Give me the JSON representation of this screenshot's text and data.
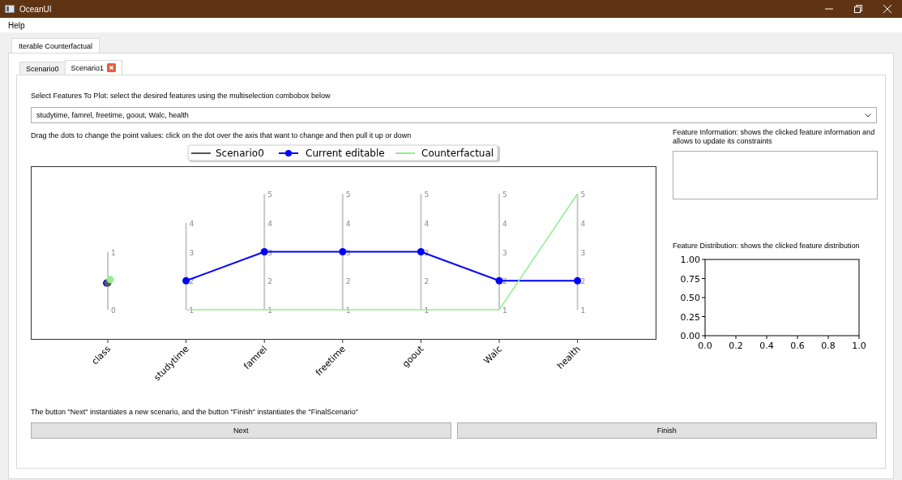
{
  "window": {
    "title": "OceanUI"
  },
  "menu": [
    "Help"
  ],
  "outer_tabs": [
    {
      "label": "Iterable Counterfactual",
      "selected": true
    }
  ],
  "scenario_tabs": [
    {
      "label": "Scenario0",
      "selected": false,
      "closable": false
    },
    {
      "label": "Scenario1",
      "selected": true,
      "closable": true
    }
  ],
  "features_label": "Select Features To Plot: select the desired features using the multiselection combobox below",
  "features_combo": {
    "value": "studytime, famrel, freetime, goout, Walc, health"
  },
  "drag_hint": "Drag the dots to change the point values: click on the dot over the axis that want to change and then pull it up or down",
  "main_chart": {
    "legend": [
      {
        "name": "Scenario0",
        "color": "#555555",
        "kind": "line"
      },
      {
        "name": "Current editable",
        "color": "#0000ff",
        "kind": "line-marker"
      },
      {
        "name": "Counterfactual",
        "color": "#90ee90",
        "kind": "line"
      }
    ],
    "axes": [
      {
        "label": "class",
        "kind": "target",
        "ticks": [
          "1",
          "0"
        ]
      },
      {
        "label": "studytime",
        "kind": "feature",
        "ticks": [
          "4",
          "3",
          "2",
          "1"
        ]
      },
      {
        "label": "famrel",
        "kind": "feature",
        "ticks": [
          "5",
          "4",
          "3",
          "2",
          "1"
        ]
      },
      {
        "label": "freetime",
        "kind": "feature",
        "ticks": [
          "5",
          "4",
          "3",
          "2",
          "1"
        ]
      },
      {
        "label": "goout",
        "kind": "feature",
        "ticks": [
          "5",
          "4",
          "3",
          "2",
          "1"
        ]
      },
      {
        "label": "Walc",
        "kind": "feature",
        "ticks": [
          "5",
          "4",
          "3",
          "2",
          "1"
        ]
      },
      {
        "label": "health",
        "kind": "feature",
        "ticks": [
          "5",
          "4",
          "3",
          "2",
          "1"
        ]
      }
    ]
  },
  "info_label": "Feature Information: shows the clicked feature information and allows to update its constraints",
  "distribution_label": "Feature Distribution: shows the clicked feature distribution",
  "distribution_chart": {
    "chart_data": {
      "type": "line",
      "xlim": [
        0,
        1
      ],
      "ylim": [
        0,
        1
      ],
      "xticks": [
        {
          "value": 0,
          "label": "0.0"
        },
        {
          "value": 0.2,
          "label": "0.2"
        },
        {
          "value": 0.4,
          "label": "0.4"
        },
        {
          "value": 0.6,
          "label": "0.6"
        },
        {
          "value": 0.8,
          "label": "0.8"
        },
        {
          "value": 1,
          "label": "1.0"
        }
      ],
      "yticks": [
        {
          "value": 0,
          "label": "0.00"
        },
        {
          "value": 0.25,
          "label": "0.25"
        },
        {
          "value": 0.5,
          "label": "0.50"
        },
        {
          "value": 0.75,
          "label": "0.75"
        },
        {
          "value": 1,
          "label": "1.00"
        }
      ]
    }
  },
  "footer_text": "The button \"Next\" instantiates a new scenario, and the button \"Finish\" instantiates the \"FinalScenario\"",
  "buttons": [
    "Next",
    "Finish"
  ]
}
